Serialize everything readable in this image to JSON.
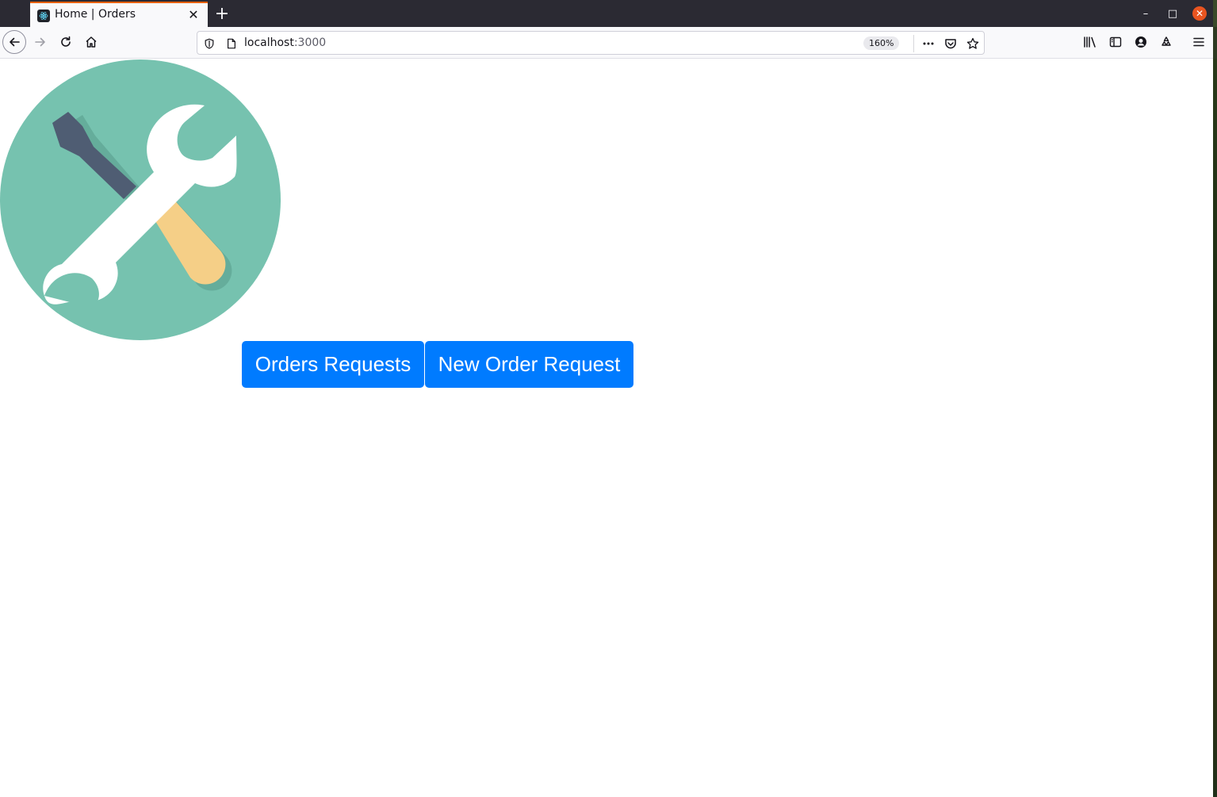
{
  "browser": {
    "tab": {
      "title": "Home | Orders",
      "close_glyph": "✕",
      "favicon": "react-atom-icon"
    },
    "new_tab_glyph": "+",
    "window_controls": {
      "minimize": "–",
      "maximize": "□",
      "close": "✕"
    },
    "url": {
      "host": "localhost",
      "port": ":3000"
    },
    "zoom": "160%",
    "accent_color": "#e66000"
  },
  "page": {
    "logo": "wrench-screwdriver-icon",
    "logo_colors": {
      "circle": "#76c2af",
      "handle": "#4f5d73",
      "grip": "#f5cf87",
      "wrench": "#ffffff"
    },
    "buttons": {
      "orders_requests": "Orders Requests",
      "new_order_request": "New Order Request"
    },
    "button_color": "#007bff"
  }
}
